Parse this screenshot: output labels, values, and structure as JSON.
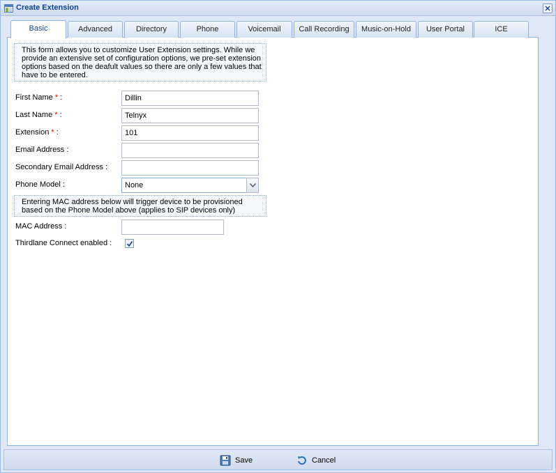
{
  "window": {
    "title": "Create Extension",
    "icon": "window-icon",
    "close_icon": "close-icon"
  },
  "tabs": [
    {
      "label": "Basic",
      "active": true
    },
    {
      "label": "Advanced"
    },
    {
      "label": "Directory"
    },
    {
      "label": "Phone"
    },
    {
      "label": "Voicemail"
    },
    {
      "label": "Call Recording"
    },
    {
      "label": "Music-on-Hold"
    },
    {
      "label": "User Portal"
    },
    {
      "label": "ICE"
    }
  ],
  "form": {
    "intro": "This form allows you to customize User Extension settings. While we provide an extensive set of configuration options, we pre-set extension options based on the deafult values so there are only a few values that have to be entered.",
    "required_marker": "*",
    "first_name": {
      "label": "First Name",
      "suffix": ":",
      "value": "Dillin"
    },
    "last_name": {
      "label": "Last Name",
      "suffix": ":",
      "value": "Telnyx"
    },
    "extension": {
      "label": "Extension",
      "suffix": ":",
      "value": "101"
    },
    "email": {
      "label": "Email Address :",
      "value": ""
    },
    "secondary_email": {
      "label": "Secondary Email Address :",
      "value": ""
    },
    "phone_model": {
      "label": "Phone Model :",
      "value": "None"
    },
    "mac_note": "Entering MAC address below will trigger device to be provisioned based on the Phone Model above (applies to SIP devices only)",
    "mac_address": {
      "label": "MAC Address :",
      "value": ""
    },
    "thirdlane_connect": {
      "label": "Thirdlane Connect enabled :",
      "checked": true
    }
  },
  "footer": {
    "save_label": "Save",
    "cancel_label": "Cancel",
    "save_icon": "save-icon",
    "cancel_icon": "cancel-icon"
  }
}
